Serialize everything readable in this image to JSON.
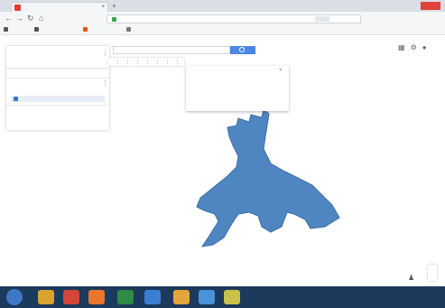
{
  "browser": {
    "tab_title": "",
    "new_tab_icon": "plus-icon",
    "url": "",
    "nav": {
      "back_icon": "arrow-left-icon",
      "forward_icon": "arrow-right-icon",
      "reload_icon": "reload-icon",
      "home_icon": "home-icon"
    },
    "url_icons": "",
    "right_icons": "",
    "bookmarks": [
      {
        "label": "",
        "color": "#555555"
      },
      {
        "label": "",
        "color": "#555555"
      },
      {
        "label": "",
        "color": "#e05a1c"
      },
      {
        "label": "",
        "color": "#777777"
      }
    ]
  },
  "sidebar": {
    "title": "",
    "subtitle": "",
    "actions": "",
    "layer_name": "",
    "style_link": "",
    "feature_label": "",
    "basemap_label": ""
  },
  "map": {
    "search_placeholder": "",
    "tools": [
      "",
      "",
      "",
      "",
      "",
      "",
      ""
    ],
    "polygon_fill": "#4f86c2",
    "polygon_stroke": "#3a6ea5",
    "google_logo": "",
    "zoom_in": "",
    "zoom_out": "",
    "attribution": ""
  },
  "info_window": {
    "title": "",
    "text": "",
    "footer": "",
    "icons": ""
  },
  "taskbar": {
    "tray": "",
    "time": "",
    "date": "",
    "apps": [
      {
        "name": "file-explorer-icon",
        "color": "#d9a332"
      },
      {
        "name": "chrome-icon",
        "color": "#d6453a"
      },
      {
        "name": "firefox-icon",
        "color": "#e8762d"
      },
      {
        "name": "excel-icon",
        "color": "#2e8a45"
      },
      {
        "name": "map-app-icon",
        "color": "#3b7fd4"
      },
      {
        "name": "store-icon",
        "color": "#e2a63a"
      },
      {
        "name": "edge-icon",
        "color": "#4a92d9"
      },
      {
        "name": "paint-icon",
        "color": "#c9c24a"
      }
    ]
  }
}
